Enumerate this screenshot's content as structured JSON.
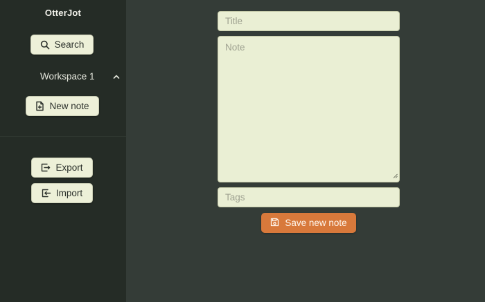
{
  "app": {
    "title": "OtterJot"
  },
  "sidebar": {
    "search_label": "Search",
    "search_icon": "search-icon",
    "workspace_label": "Workspace 1",
    "workspace_icon": "chevron-up-icon",
    "new_note_label": "New note",
    "new_note_icon": "file-plus-icon",
    "export_label": "Export",
    "export_icon": "export-icon",
    "import_label": "Import",
    "import_icon": "import-icon"
  },
  "editor": {
    "title_placeholder": "Title",
    "note_placeholder": "Note",
    "tags_placeholder": "Tags",
    "save_label": "Save new note",
    "save_icon": "save-icon"
  },
  "colors": {
    "sidebar_bg": "#252c26",
    "main_bg": "#343c37",
    "field_bg": "#eaefd4",
    "accent": "#d8793b"
  }
}
